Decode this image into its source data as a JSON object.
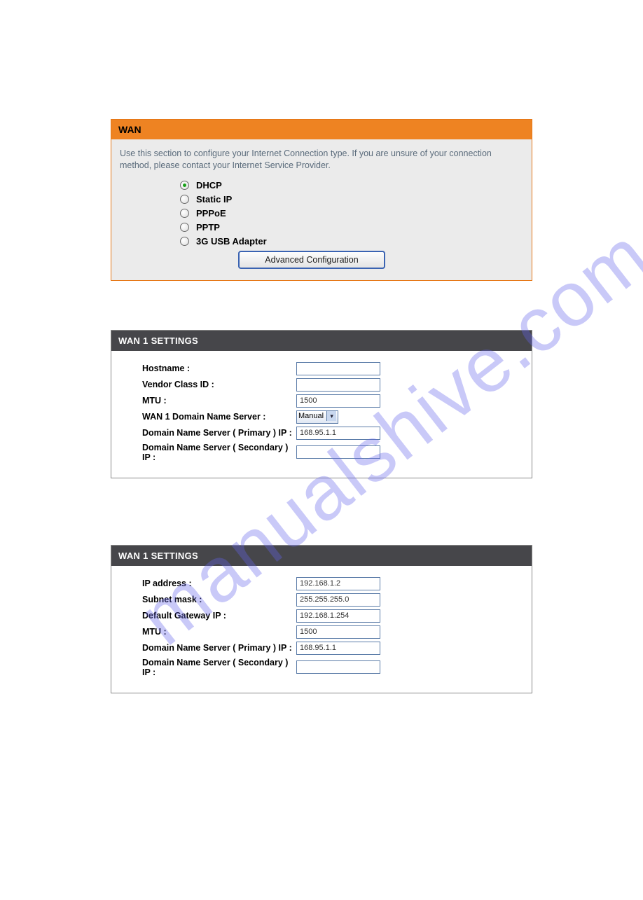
{
  "wan": {
    "title": "WAN",
    "description": "Use this section to configure your Internet Connection type. If you are unsure of your connection method, please contact your Internet Service Provider.",
    "options": {
      "dhcp": "DHCP",
      "static": "Static IP",
      "pppoe": "PPPoE",
      "pptp": "PPTP",
      "usb3g": "3G USB Adapter"
    },
    "advanced_btn": "Advanced Configuration"
  },
  "settings1": {
    "title": "WAN 1 SETTINGS",
    "rows": {
      "hostname": {
        "label": "Hostname  :",
        "value": ""
      },
      "vendor": {
        "label": "Vendor Class ID :",
        "value": ""
      },
      "mtu": {
        "label": "MTU :",
        "value": "1500"
      },
      "dns_mode": {
        "label": "WAN 1 Domain Name Server :",
        "value": "Manual"
      },
      "dns_p": {
        "label": "Domain Name Server ( Primary ) IP :",
        "value": "168.95.1.1"
      },
      "dns_s": {
        "label": "Domain Name Server ( Secondary ) IP :",
        "value": ""
      }
    }
  },
  "settings2": {
    "title": "WAN 1 SETTINGS",
    "rows": {
      "ip": {
        "label": "IP address :",
        "value": "192.168.1.2"
      },
      "mask": {
        "label": "Subnet mask :",
        "value": "255.255.255.0"
      },
      "gw": {
        "label": "Default Gateway IP :",
        "value": "192.168.1.254"
      },
      "mtu": {
        "label": "MTU :",
        "value": "1500"
      },
      "dns_p": {
        "label": "Domain Name Server ( Primary ) IP :",
        "value": "168.95.1.1"
      },
      "dns_s": {
        "label": "Domain Name Server ( Secondary ) IP :",
        "value": ""
      }
    }
  }
}
